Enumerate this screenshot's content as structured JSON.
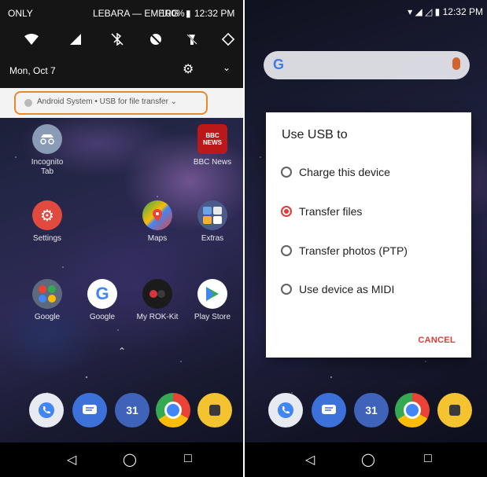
{
  "left": {
    "status_bar": {
      "carrier_left": "ONLY",
      "carrier_right": "LEBARA — EMERG",
      "battery": "100%",
      "time": "12:32 PM"
    },
    "quick_settings": [
      "wifi-icon",
      "signal-icon",
      "bluetooth-off-icon",
      "dnd-icon",
      "flashlight-off-icon",
      "auto-rotate-icon"
    ],
    "date": "Mon, Oct 7",
    "notification": {
      "text": "Android System • USB for file transfer ⌄"
    },
    "apps": [
      {
        "label": "Incognito Tab",
        "line1": "Incognito",
        "line2": "Tab"
      },
      {
        "label": "BBC News"
      },
      {
        "label": "Settings"
      },
      {
        "label": "Maps"
      },
      {
        "label": "Extras"
      },
      {
        "label": "Google"
      },
      {
        "label": "Google"
      },
      {
        "label": "My ROK-Kit"
      },
      {
        "label": "Play Store"
      }
    ],
    "bbc_icon_text": {
      "top": "BBC",
      "bottom": "NEWS"
    },
    "dock_calendar": "31"
  },
  "right": {
    "status_bar": {
      "time": "12:32 PM"
    },
    "search_logo": "G",
    "dialog": {
      "title": "Use USB to",
      "options": [
        {
          "label": "Charge this device",
          "selected": false
        },
        {
          "label": "Transfer files",
          "selected": true
        },
        {
          "label": "Transfer photos (PTP)",
          "selected": false
        },
        {
          "label": "Use device as MIDI",
          "selected": false
        }
      ],
      "cancel_label": "CANCEL"
    },
    "dock_calendar": "31"
  },
  "colors": {
    "accent": "#e53935",
    "highlight": "#e88a2c"
  }
}
